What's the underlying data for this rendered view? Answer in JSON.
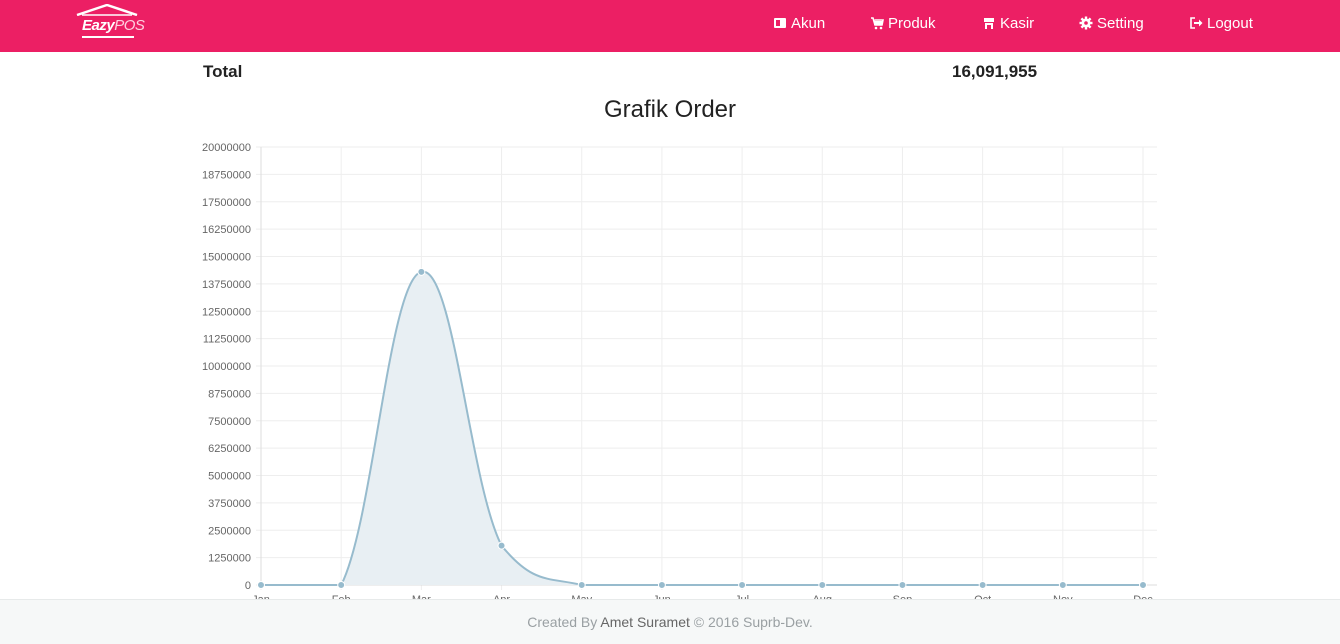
{
  "brand": {
    "logo_text_1": "Eazy",
    "logo_text_2": "POS"
  },
  "nav": {
    "akun": "Akun",
    "produk": "Produk",
    "kasir": "Kasir",
    "setting": "Setting",
    "logout": "Logout"
  },
  "summary": {
    "total_label": "Total",
    "total_value": "16,091,955"
  },
  "chart_title": "Grafik Order",
  "chart_data": {
    "type": "area",
    "title": "Grafik Order",
    "categories": [
      "Jan",
      "Feb",
      "Mar",
      "Apr",
      "May",
      "Jun",
      "Jul",
      "Aug",
      "Sep",
      "Oct",
      "Nov",
      "Dec"
    ],
    "series": [
      {
        "values": [
          0,
          0,
          14300000,
          1800000,
          0,
          0,
          0,
          0,
          0,
          0,
          0,
          0
        ]
      }
    ],
    "ylim": [
      0,
      20000000
    ],
    "yticks": [
      0,
      1250000,
      2500000,
      3750000,
      5000000,
      6250000,
      7500000,
      8750000,
      10000000,
      11250000,
      12500000,
      13750000,
      15000000,
      16250000,
      17500000,
      18750000,
      20000000
    ],
    "grid": true,
    "colors": {
      "line": "#97bbcd",
      "fill": "#e8eff3",
      "point": "#97bbcd"
    }
  },
  "footer": {
    "prefix": "Created By",
    "author": "Amet Suramet",
    "suffix": "© 2016 Suprb-Dev."
  }
}
